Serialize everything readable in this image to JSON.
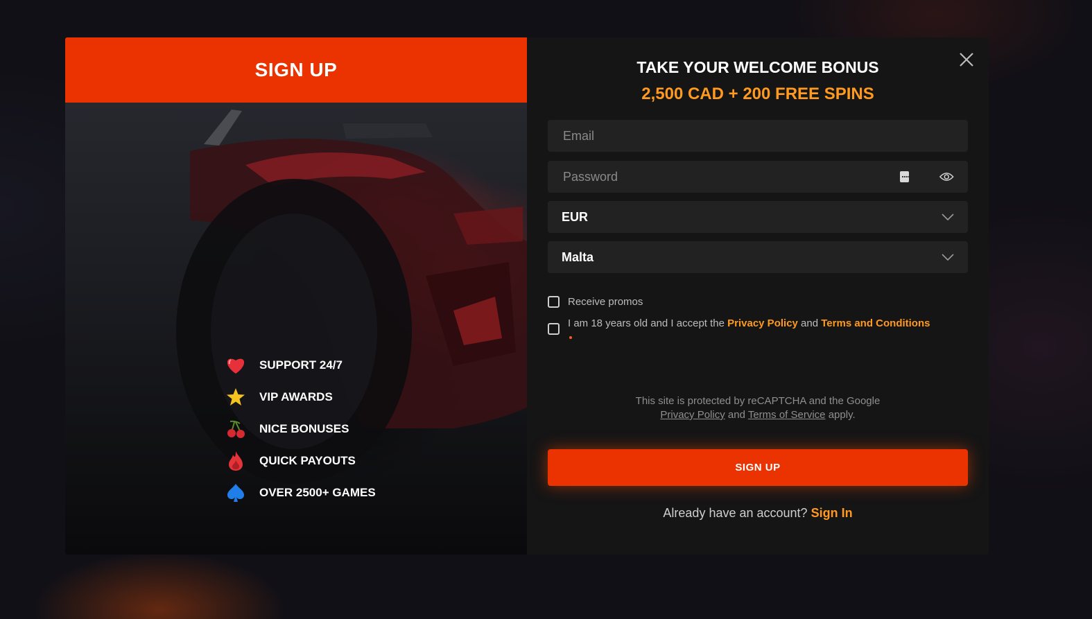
{
  "left_panel": {
    "header": "SIGN UP",
    "features": [
      {
        "icon": "heart-icon",
        "label": "SUPPORT 24/7"
      },
      {
        "icon": "star-icon",
        "label": "VIP AWARDS"
      },
      {
        "icon": "cherries-icon",
        "label": "NICE BONUSES"
      },
      {
        "icon": "fire-icon",
        "label": "QUICK PAYOUTS"
      },
      {
        "icon": "spade-icon",
        "label": "OVER 2500+ GAMES"
      }
    ]
  },
  "form": {
    "title": "TAKE YOUR WELCOME BONUS",
    "bonus": "2,500 CAD + 200 FREE SPINS",
    "email": {
      "placeholder": "Email",
      "value": ""
    },
    "password": {
      "placeholder": "Password",
      "value": ""
    },
    "currency": {
      "value": "EUR"
    },
    "country": {
      "value": "Malta"
    },
    "promos_label": "Receive promos",
    "promos_checked": false,
    "terms": {
      "prefix": "I am 18 years old and I accept the",
      "privacy": "Privacy Policy",
      "and": "and",
      "terms": "Terms and Conditions",
      "checked": false
    },
    "recaptcha": {
      "line1": "This site is protected by reCAPTCHA and the Google",
      "privacy": "Privacy Policy",
      "and": "and",
      "tos": "Terms of Service",
      "suffix": "apply."
    },
    "submit_label": "SIGN UP",
    "signin_prompt": "Already have an account?",
    "signin_link": "Sign In"
  },
  "colors": {
    "accent": "#ea3300",
    "bonus": "#ff9a1f",
    "panel_bg": "#151515",
    "field_bg": "#222222"
  }
}
